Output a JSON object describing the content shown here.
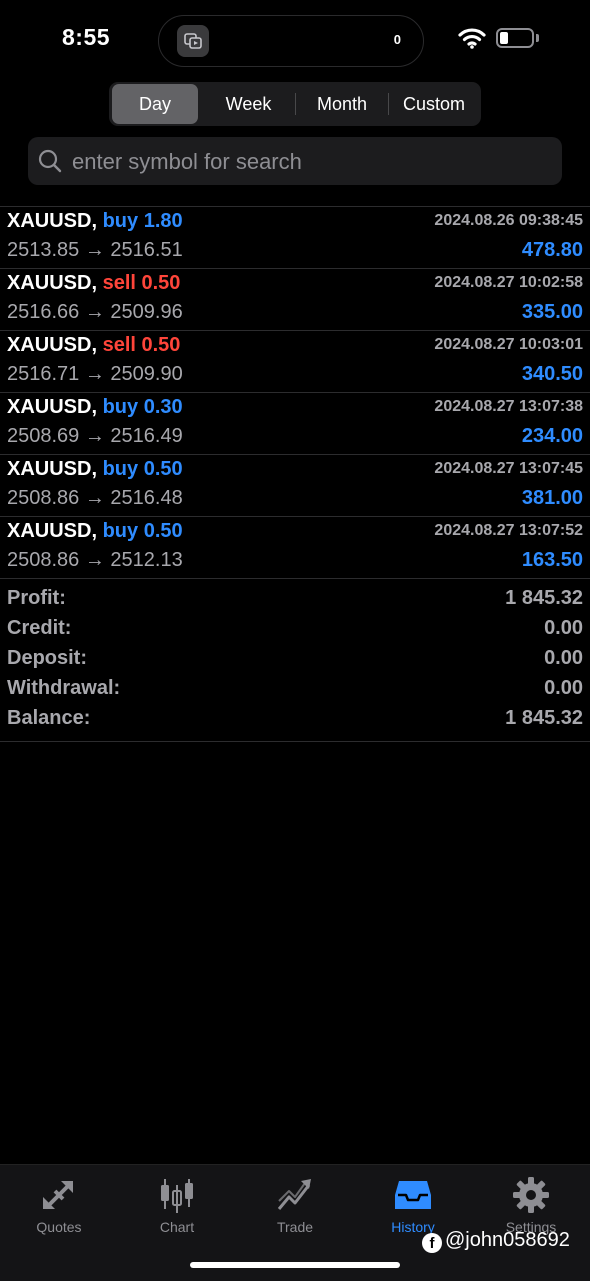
{
  "status_bar": {
    "time": "8:55",
    "notification_count": "0"
  },
  "segments": [
    {
      "label": "Day",
      "active": true
    },
    {
      "label": "Week",
      "active": false
    },
    {
      "label": "Month",
      "active": false
    },
    {
      "label": "Custom",
      "active": false
    }
  ],
  "search": {
    "placeholder": "enter symbol for search",
    "value": ""
  },
  "deals": [
    {
      "symbol": "XAUUSD,",
      "type": "buy",
      "volume": "1.80",
      "type_label": "buy 1.80",
      "date": "2024.08.26 09:38:45",
      "prices": "2513.85 → 2516.51",
      "profit": "478.80"
    },
    {
      "symbol": "XAUUSD,",
      "type": "sell",
      "volume": "0.50",
      "type_label": "sell 0.50",
      "date": "2024.08.27 10:02:58",
      "prices": "2516.66 → 2509.96",
      "profit": "335.00"
    },
    {
      "symbol": "XAUUSD,",
      "type": "sell",
      "volume": "0.50",
      "type_label": "sell 0.50",
      "date": "2024.08.27 10:03:01",
      "prices": "2516.71 → 2509.90",
      "profit": "340.50"
    },
    {
      "symbol": "XAUUSD,",
      "type": "buy",
      "volume": "0.30",
      "type_label": "buy 0.30",
      "date": "2024.08.27 13:07:38",
      "prices": "2508.69 → 2516.49",
      "profit": "234.00"
    },
    {
      "symbol": "XAUUSD,",
      "type": "buy",
      "volume": "0.50",
      "type_label": "buy 0.50",
      "date": "2024.08.27 13:07:45",
      "prices": "2508.86 → 2516.48",
      "profit": "381.00"
    },
    {
      "symbol": "XAUUSD,",
      "type": "buy",
      "volume": "0.50",
      "type_label": "buy 0.50",
      "date": "2024.08.27 13:07:52",
      "prices": "2508.86 → 2512.13",
      "profit": "163.50"
    }
  ],
  "summary": {
    "profit": {
      "label": "Profit:",
      "value": "1 845.32"
    },
    "credit": {
      "label": "Credit:",
      "value": "0.00"
    },
    "deposit": {
      "label": "Deposit:",
      "value": "0.00"
    },
    "withdrawal": {
      "label": "Withdrawal:",
      "value": "0.00"
    },
    "balance": {
      "label": "Balance:",
      "value": "1 845.32"
    }
  },
  "tabbar": [
    {
      "label": "Quotes",
      "icon": "quotes-icon",
      "active": false
    },
    {
      "label": "Chart",
      "icon": "candlestick-chart-icon",
      "active": false
    },
    {
      "label": "Trade",
      "icon": "trade-trend-icon",
      "active": false
    },
    {
      "label": "History",
      "icon": "history-inbox-icon",
      "active": true
    },
    {
      "label": "Settings",
      "icon": "gear-icon",
      "active": false
    }
  ],
  "watermark": "@john058692",
  "colors": {
    "accent": "#2f8cff",
    "sell": "#ff453a",
    "background": "#000000",
    "muted": "#a8a8ad"
  }
}
